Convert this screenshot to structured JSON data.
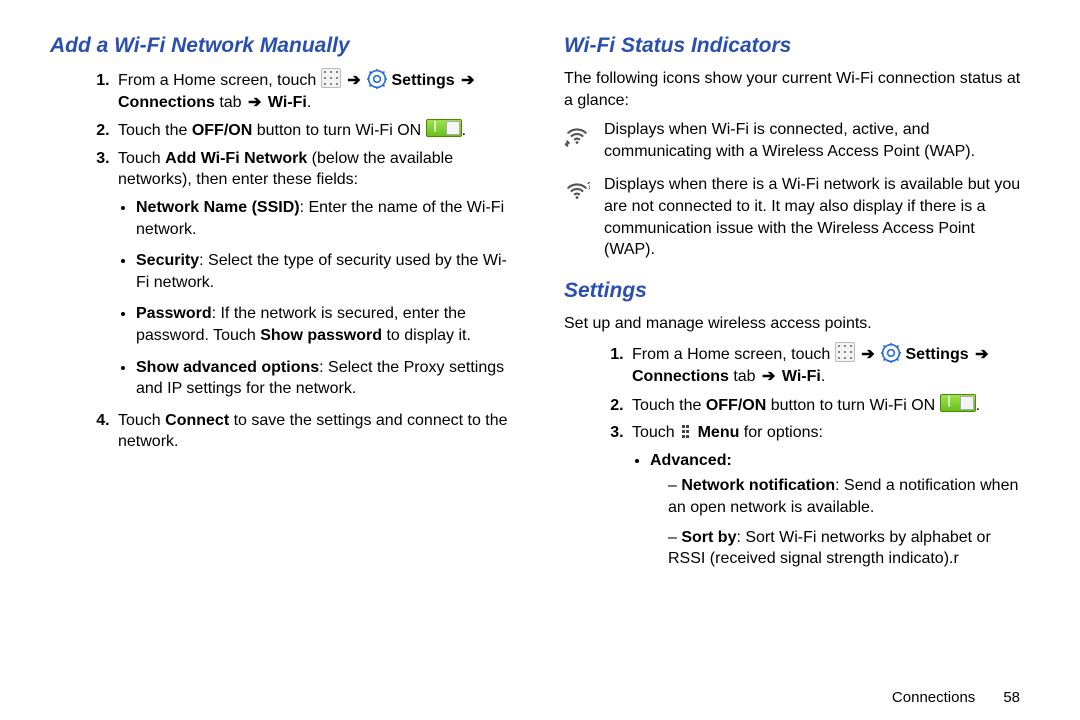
{
  "arrow_glyph": "➔",
  "left": {
    "heading": "Add a Wi-Fi Network Manually",
    "step1_a": "From a Home screen, touch ",
    "step1_settings": " Settings ",
    "step1_b": "Connections",
    "step1_c": " tab ",
    "step1_wifi": " Wi-Fi",
    "step2_a": "Touch the ",
    "step2_b": "OFF/ON",
    "step2_c": " button to turn Wi-Fi ON ",
    "step3_a": "Touch ",
    "step3_b": "Add Wi-Fi Network",
    "step3_c": " (below the available networks), then enter these fields:",
    "b1_a": "Network Name (SSID)",
    "b1_b": ": Enter the name of the Wi-Fi network.",
    "b2_a": "Security",
    "b2_b": ": Select the type of security used by the Wi-Fi network.",
    "b3_a": "Password",
    "b3_b": ": If the network is secured, enter the password. Touch ",
    "b3_c": "Show password",
    "b3_d": " to display it.",
    "b4_a": "Show advanced options",
    "b4_b": ": Select the Proxy settings and IP settings for the network.",
    "step4_a": "Touch ",
    "step4_b": "Connect",
    "step4_c": " to save the settings and connect to the network."
  },
  "right": {
    "heading1": "Wi-Fi Status Indicators",
    "intro1": "The following icons show your current Wi-Fi connection status at a glance:",
    "ic1": "Displays when Wi-Fi is connected, active, and communicating with a Wireless Access Point (WAP).",
    "ic2": "Displays when there is a Wi-Fi network is available but you are not connected to it. It may also display if there is a communication issue with the Wireless Access Point (WAP).",
    "heading2": "Settings",
    "intro2": "Set up and manage wireless access points.",
    "step1_a": "From a Home screen, touch ",
    "step1_settings": " Settings ",
    "step1_b": "Connections",
    "step1_c": " tab ",
    "step1_wifi": " Wi-Fi",
    "step2_a": "Touch the ",
    "step2_b": "OFF/ON",
    "step2_c": " button to turn Wi-Fi ON ",
    "step3_a": "Touch ",
    "step3_menu": " Menu",
    "step3_b": " for options:",
    "adv": "Advanced:",
    "d1_a": "Network notification",
    "d1_b": ": Send a notification when an open network is available.",
    "d2_a": "Sort by",
    "d2_b": ": Sort Wi-Fi networks by alphabet or RSSI (received signal strength indicato).r"
  },
  "footer": {
    "section": "Connections",
    "page": "58"
  },
  "dot": "."
}
